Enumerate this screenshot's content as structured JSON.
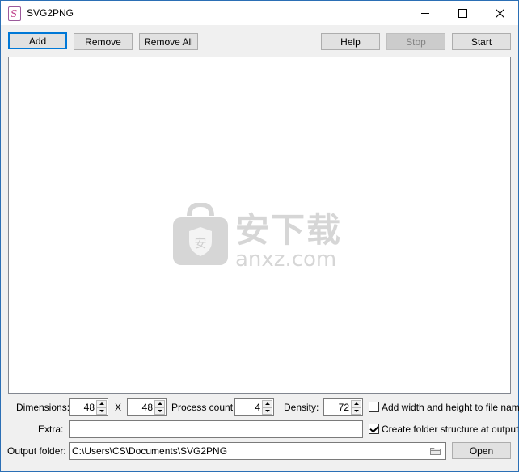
{
  "window": {
    "title": "SVG2PNG",
    "app_icon_letter": "S"
  },
  "toolbar": {
    "add_label": "Add",
    "remove_label": "Remove",
    "remove_all_label": "Remove All",
    "help_label": "Help",
    "stop_label": "Stop",
    "start_label": "Start"
  },
  "watermark": {
    "title": "安下载",
    "url": "anxz.com",
    "logo_char": "安"
  },
  "options": {
    "dimensions_label": "Dimensions:",
    "width_value": "48",
    "x_label": "X",
    "height_value": "48",
    "process_count_label": "Process count:",
    "process_count_value": "4",
    "density_label": "Density:",
    "density_value": "72",
    "add_size_label": "Add width and height to file name",
    "add_size_checked": false,
    "extra_label": "Extra:",
    "extra_value": "",
    "folder_structure_label": "Create folder structure at output",
    "folder_structure_checked": true,
    "output_folder_label": "Output folder:",
    "output_folder_value": "C:\\Users\\CS\\Documents\\SVG2PNG",
    "open_label": "Open"
  },
  "icons": {
    "browse": "folder-icon",
    "close": "close-icon",
    "minimize": "minimize-icon",
    "maximize": "maximize-icon"
  },
  "colors": {
    "accent": "#0078d7",
    "window_border": "#2b6fb5"
  }
}
